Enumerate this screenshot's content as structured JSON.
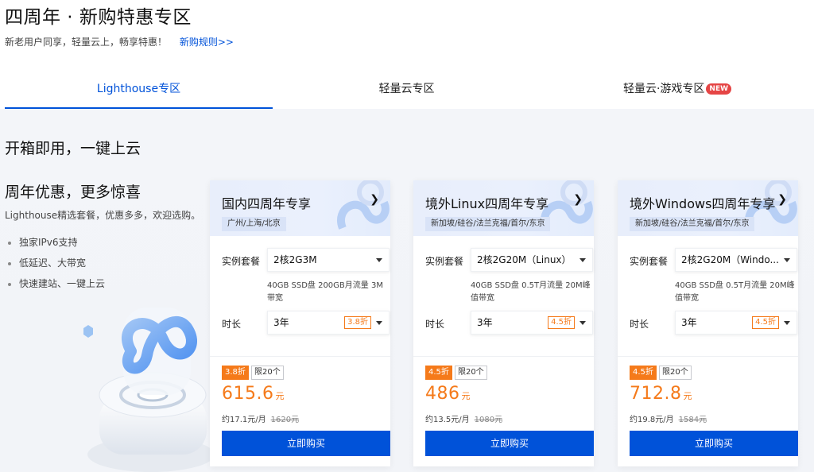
{
  "header": {
    "title": "四周年 · 新购特惠专区",
    "subtitle": "新老用户同享，轻量云上，畅享特惠！",
    "rules_link": "新购规则>>"
  },
  "tabs": [
    {
      "label": "Lighthouse专区",
      "active": true
    },
    {
      "label": "轻量云专区",
      "active": false
    },
    {
      "label": "轻量云·游戏专区",
      "active": false,
      "badge": "NEW"
    }
  ],
  "main": {
    "section_title": "开箱即用，一键上云",
    "promo_title": "周年优惠，更多惊喜",
    "promo_desc": "Lighthouse精选套餐，优惠多多，欢迎选购。",
    "features": [
      "独家IPv6支持",
      "低延迟、大带宽",
      "快速建站、一键上云"
    ]
  },
  "labels": {
    "instance_label": "实例套餐",
    "duration_label": "时长",
    "buy_label": "立即购买"
  },
  "cards": [
    {
      "title": "国内四周年专享",
      "regions": "广州/上海/北京",
      "instance": "2核2G3M",
      "spec": "40GB SSD盘 200GB月流量 3M带宽",
      "duration": "3年",
      "duration_discount": "3.8折",
      "discount": "3.8折",
      "limit": "限20个",
      "price": "615.6",
      "price_unit": "元",
      "monthly": "约17.1元/月",
      "original": "1620元"
    },
    {
      "title": "境外Linux四周年专享",
      "regions": "新加坡/硅谷/法兰克福/首尔/东京",
      "instance": "2核2G20M（Linux）",
      "spec": "40GB SSD盘 0.5T月流量 20M峰值带宽",
      "duration": "3年",
      "duration_discount": "4.5折",
      "discount": "4.5折",
      "limit": "限20个",
      "price": "486",
      "price_unit": "元",
      "monthly": "约13.5元/月",
      "original": "1080元"
    },
    {
      "title": "境外Windows四周年专享",
      "regions": "新加坡/硅谷/法兰克福/首尔/东京",
      "instance": "2核2G20M（Windo...",
      "spec": "40GB SSD盘 0.5T月流量 20M峰值带宽",
      "duration": "3年",
      "duration_discount": "4.5折",
      "discount": "4.5折",
      "limit": "限20个",
      "price": "712.8",
      "price_unit": "元",
      "monthly": "约19.8元/月",
      "original": "1584元"
    }
  ],
  "colors": {
    "primary": "#0052d9",
    "accent_orange": "#f57a1a",
    "new_badge": "#e54545"
  }
}
